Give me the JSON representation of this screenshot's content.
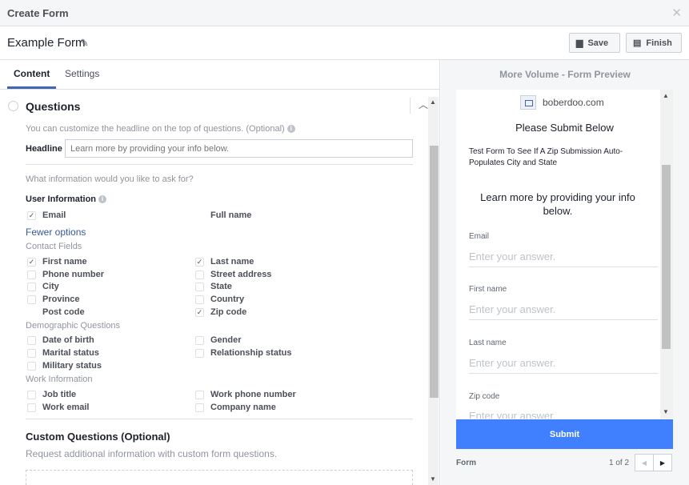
{
  "window": {
    "title": "Create Form"
  },
  "header": {
    "form_name": "Example Form",
    "save_label": "Save",
    "finish_label": "Finish"
  },
  "tabs": [
    {
      "label": "Content"
    },
    {
      "label": "Settings"
    }
  ],
  "questions": {
    "title": "Questions",
    "headline_hint": "You can customize the headline on the top of questions. (Optional)",
    "headline_label": "Headline",
    "headline_placeholder": "Learn more by providing your info below.",
    "ask_prompt": "What information would you like to ask for?",
    "user_info_label": "User Information",
    "user_info": [
      {
        "label": "Email",
        "checked": true
      },
      {
        "label": "Full name",
        "checked": false
      }
    ],
    "fewer_options": "Fewer options",
    "contact_label": "Contact Fields",
    "contact_left": [
      {
        "label": "First name",
        "checked": true
      },
      {
        "label": "Phone number",
        "checked": false
      },
      {
        "label": "City",
        "checked": false
      },
      {
        "label": "Province",
        "checked": false
      },
      {
        "label": "Post code",
        "checked": false
      }
    ],
    "contact_right": [
      {
        "label": "Last name",
        "checked": true
      },
      {
        "label": "Street address",
        "checked": false
      },
      {
        "label": "State",
        "checked": false
      },
      {
        "label": "Country",
        "checked": false
      },
      {
        "label": "Zip code",
        "checked": true
      }
    ],
    "demographic_label": "Demographic Questions",
    "demographic_left": [
      {
        "label": "Date of birth",
        "checked": false
      },
      {
        "label": "Marital status",
        "checked": false
      },
      {
        "label": "Military status",
        "checked": false
      }
    ],
    "demographic_right": [
      {
        "label": "Gender",
        "checked": false
      },
      {
        "label": "Relationship status",
        "checked": false
      }
    ],
    "work_label": "Work Information",
    "work_left": [
      {
        "label": "Job title",
        "checked": false
      },
      {
        "label": "Work email",
        "checked": false
      }
    ],
    "work_right": [
      {
        "label": "Work phone number",
        "checked": false
      },
      {
        "label": "Company name",
        "checked": false
      }
    ],
    "custom_title": "Custom Questions (Optional)",
    "custom_hint": "Request additional information with custom form questions."
  },
  "preview": {
    "title": "More Volume - Form Preview",
    "brand": "boberdoo.com",
    "heading": "Please Submit Below",
    "description": "Test Form To See If A Zip Submission Auto-Populates City and State",
    "headline": "Learn more by providing your info below.",
    "fields": [
      {
        "label": "Email",
        "placeholder": "Enter your answer."
      },
      {
        "label": "First name",
        "placeholder": "Enter your answer."
      },
      {
        "label": "Last name",
        "placeholder": "Enter your answer."
      },
      {
        "label": "Zip code",
        "placeholder": "Enter your answer."
      }
    ],
    "submit_label": "Submit",
    "footer_label": "Form",
    "page_indicator": "1 of 2"
  },
  "icons": {
    "close": "close-icon",
    "edit": "pencil-icon",
    "save": "save-icon",
    "finish": "finish-icon",
    "info": "info-icon",
    "collapse": "chevron-up-icon",
    "prev": "chevron-left-icon",
    "next": "chevron-right-icon"
  }
}
